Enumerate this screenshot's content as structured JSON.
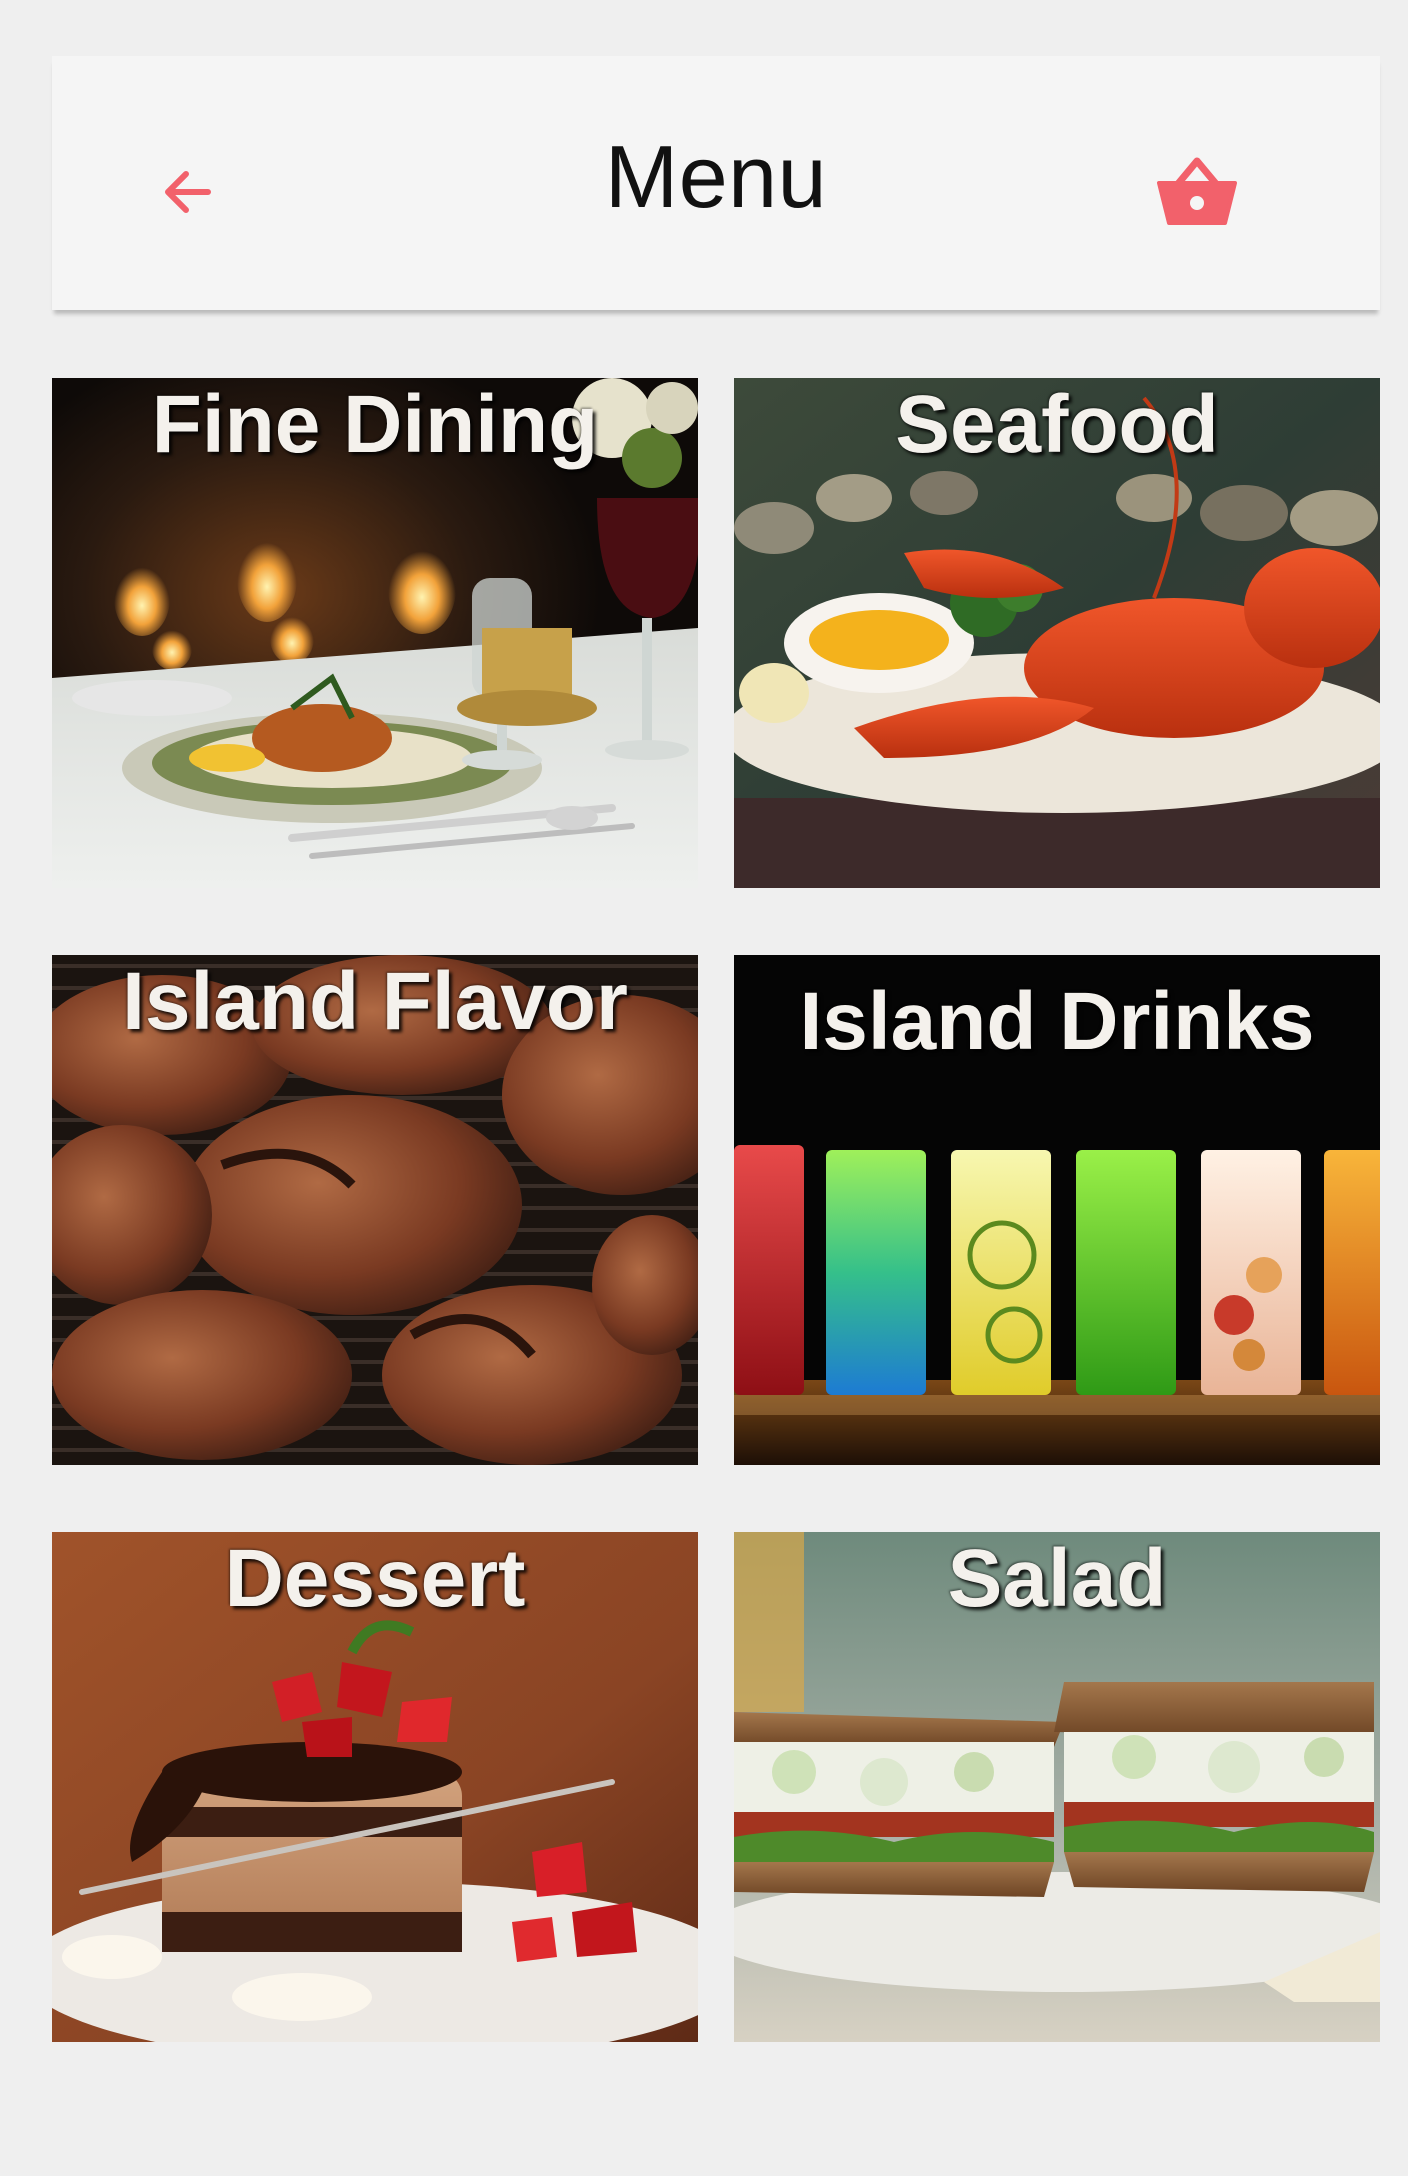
{
  "header": {
    "title": "Menu",
    "back_icon": "arrow-left-icon",
    "cart_icon": "shopping-basket-icon"
  },
  "colors": {
    "accent": "#f2616b",
    "background": "#efefef",
    "header_bg": "#f5f5f5"
  },
  "categories": [
    {
      "label": "Fine Dining"
    },
    {
      "label": "Seafood"
    },
    {
      "label": "Island Flavor"
    },
    {
      "label": "Island Drinks"
    },
    {
      "label": "Dessert"
    },
    {
      "label": "Salad"
    }
  ]
}
